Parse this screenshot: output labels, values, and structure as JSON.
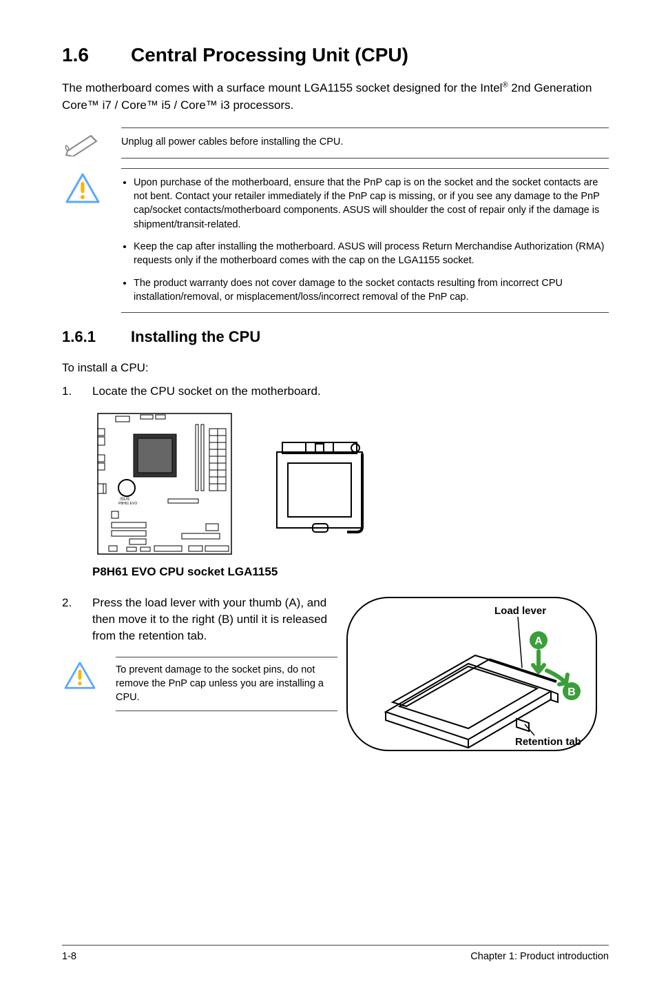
{
  "heading": {
    "number": "1.6",
    "title": "Central Processing Unit (CPU)"
  },
  "intro": {
    "part1": "The motherboard comes with a surface mount LGA1155 socket designed for the Intel",
    "reg": "®",
    "part2": " 2nd Generation Core™ i7 / Core™ i5 / Core™ i3 processors."
  },
  "note_unplug": "Unplug all power cables before installing the CPU.",
  "bullets": [
    "Upon purchase of the motherboard, ensure that the PnP cap is on the socket and the socket contacts are not bent. Contact your retailer immediately if the PnP cap is missing, or if you see any damage to the PnP cap/socket contacts/motherboard components. ASUS will shoulder the cost of repair only if the damage is shipment/transit-related.",
    "Keep the cap after installing the motherboard. ASUS will process Return Merchandise Authorization (RMA) requests only if the motherboard comes with the cap on the LGA1155 socket.",
    "The product warranty does not cover damage to the socket contacts resulting from incorrect CPU installation/removal, or misplacement/loss/incorrect removal of the PnP cap."
  ],
  "subheading": {
    "number": "1.6.1",
    "title": "Installing the CPU"
  },
  "toinstall": "To install a CPU:",
  "step1": "Locate the CPU socket on the motherboard.",
  "mobo_label": "P8H61 EVO",
  "caption": "P8H61 EVO CPU socket LGA1155",
  "step2": "Press the load lever with your thumb (A), and then move it to the right (B) until it is released from the retention tab.",
  "step2_note": "To prevent damage to the socket pins, do not remove the PnP cap unless you are installing a CPU.",
  "lever_diagram": {
    "load_lever": "Load lever",
    "retention_tab": "Retention tab",
    "a": "A",
    "b": "B"
  },
  "footer": {
    "page": "1-8",
    "chapter": "Chapter 1: Product introduction"
  },
  "icons": {
    "pen": "pen-icon",
    "caution": "caution-icon"
  }
}
